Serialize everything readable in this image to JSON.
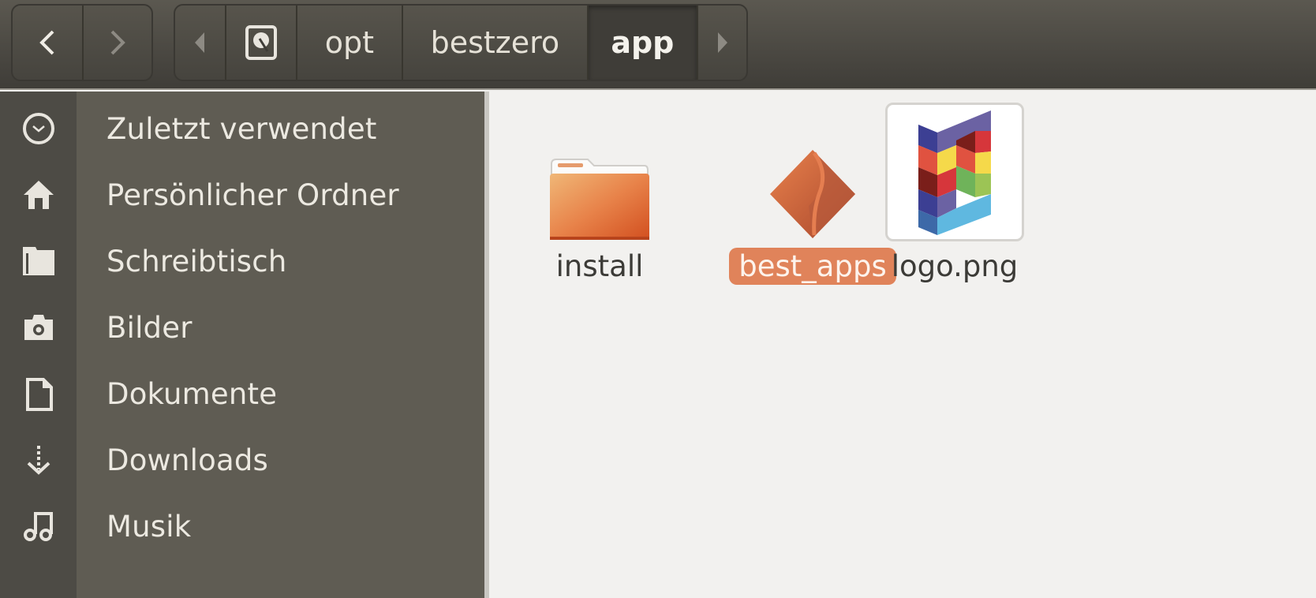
{
  "navigation": {
    "back_icon": "chevron-left-icon",
    "forward_icon": "chevron-right-icon"
  },
  "pathbar": {
    "scroll_left_icon": "triangle-left-icon",
    "root_icon": "harddisk-icon",
    "segments": [
      "opt",
      "bestzero",
      "app"
    ],
    "current": "app",
    "scroll_right_icon": "triangle-right-icon"
  },
  "sidebar": {
    "items": [
      {
        "label": "Zuletzt verwendet",
        "icon": "clock-icon"
      },
      {
        "label": "Persönlicher Ordner",
        "icon": "home-icon"
      },
      {
        "label": "Schreibtisch",
        "icon": "folder-icon"
      },
      {
        "label": "Bilder",
        "icon": "camera-icon"
      },
      {
        "label": "Dokumente",
        "icon": "document-icon"
      },
      {
        "label": "Downloads",
        "icon": "download-icon"
      },
      {
        "label": "Musik",
        "icon": "music-icon"
      }
    ]
  },
  "files": [
    {
      "name": "install",
      "type": "folder",
      "selected": false
    },
    {
      "name": "best_apps",
      "type": "executable",
      "selected": true
    },
    {
      "name": "logo.png",
      "type": "image",
      "selected": false
    }
  ],
  "colors": {
    "accent": "#e0835a",
    "sidebar_bg": "#5f5c53",
    "content_bg": "#f2f1ef"
  }
}
